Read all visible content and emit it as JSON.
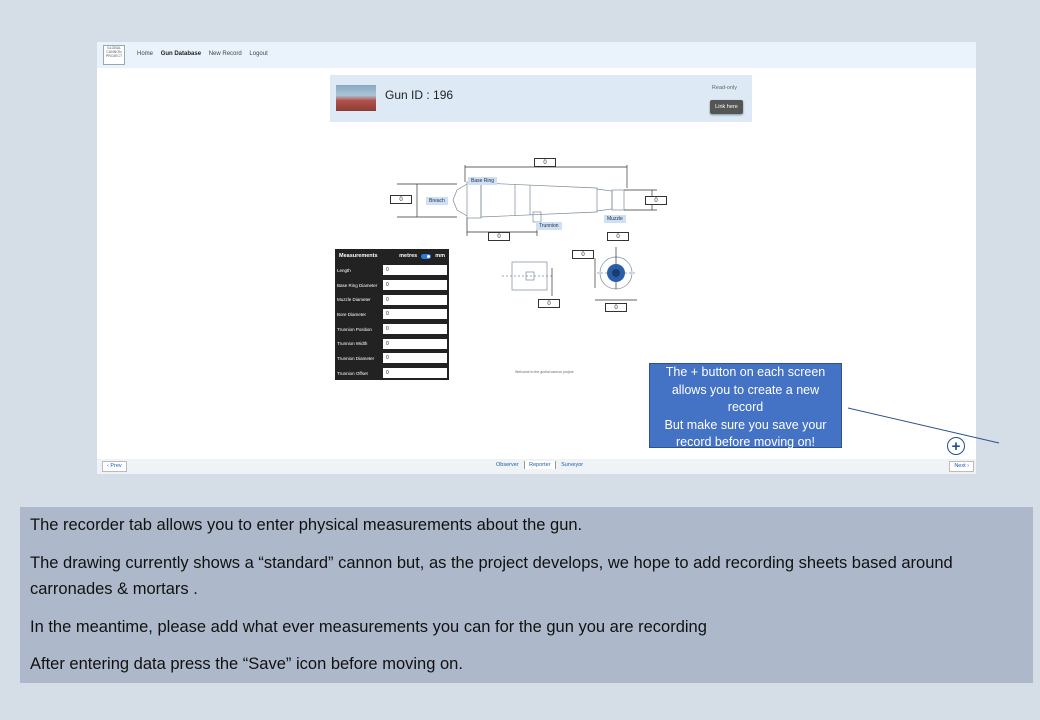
{
  "nav": {
    "logo_text": "GLOBAL CANNON PROJECT",
    "links": [
      "Home",
      "Gun Database",
      "New Record",
      "Logout"
    ]
  },
  "header": {
    "gun_id": "Gun ID : 196",
    "readonly_label": "Read-only",
    "link_button": "Link here"
  },
  "diagram": {
    "labels": {
      "breach": "Breach",
      "base_ring": "Base Ring",
      "trunnion": "Trunnion",
      "muzzle": "Muzzle"
    },
    "values": {
      "length": "0",
      "breach_diameter": "0",
      "muzzle_diameter": "0",
      "trunnion_position": "0",
      "trunnion_width": "0",
      "trunnion_offset": "0",
      "trunnion_diameter": "0",
      "bore_diameter": "0"
    }
  },
  "measurements": {
    "title": "Measurements",
    "unit_left": "metres",
    "unit_right": "mm",
    "rows": [
      {
        "label": "Length",
        "value": "0"
      },
      {
        "label": "Base Ring Diameter",
        "value": "0"
      },
      {
        "label": "Muzzle Diameter",
        "value": "0"
      },
      {
        "label": "Bore Diameter",
        "value": "0"
      },
      {
        "label": "Trunnion Position",
        "value": "0"
      },
      {
        "label": "Trunnion Width",
        "value": "0"
      },
      {
        "label": "Trunnion Diameter",
        "value": "0"
      },
      {
        "label": "Trunnion Offset",
        "value": "0"
      }
    ]
  },
  "welcome": "Welcome   to the global cannon project",
  "tooltip": {
    "lines": [
      "The + button on each screen",
      "allows you to create a new",
      "record",
      "But make sure you save your",
      "record before moving on!"
    ]
  },
  "fab": "+",
  "footer": {
    "prev": "‹ Prev",
    "next": "Next ›",
    "tabs": [
      "Observer",
      "Reporter",
      "Surveyor"
    ],
    "active_tab": "Reporter"
  },
  "caption": {
    "paragraphs": [
      "The recorder tab allows you to enter physical measurements about the gun.",
      "The drawing currently shows a “standard” cannon but, as the project develops, we hope to add recording sheets based around carronades & mortars .",
      "In the meantime, please add what ever measurements you can for the gun you are recording",
      "After entering data press the “Save” icon before moving on."
    ]
  },
  "colors": {
    "accent": "#4472c4",
    "caption_bg": "#adb9ca",
    "page_bg": "#d5dde7"
  }
}
